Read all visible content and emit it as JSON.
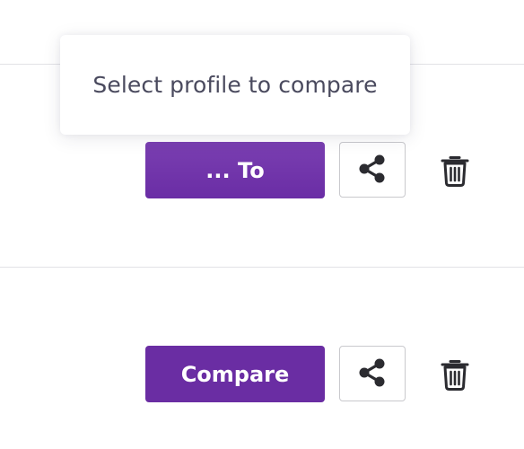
{
  "tooltip": {
    "text": "Select profile to compare"
  },
  "rows": [
    {
      "primary_label": "... To",
      "primary_state": "active",
      "share_icon": "share-icon",
      "delete_icon": "trash-icon"
    },
    {
      "primary_label": "Compare",
      "primary_state": "normal",
      "share_icon": "share-icon",
      "delete_icon": "trash-icon"
    }
  ],
  "colors": {
    "primary": "#6a2da3",
    "icon": "#2b2b30",
    "border": "#c9c9cd",
    "divider": "#e2e2e6",
    "tooltip_text": "#4a4a5e"
  }
}
